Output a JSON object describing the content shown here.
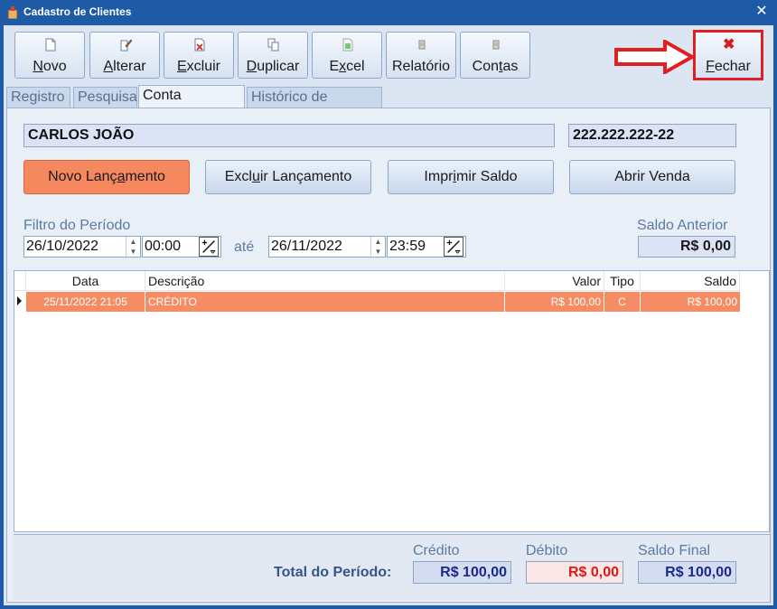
{
  "window": {
    "title": "Cadastro de Clientes",
    "close_glyph": "✕"
  },
  "toolbar": {
    "novo": {
      "label": "Novo",
      "icon": "new-document-icon"
    },
    "alterar": {
      "label": "Alterar",
      "icon": "edit-document-icon"
    },
    "excluir": {
      "label": "Excluir",
      "icon": "delete-document-icon"
    },
    "duplicar": {
      "label": "Duplicar",
      "icon": "duplicate-document-icon"
    },
    "excel": {
      "label": "Excel",
      "icon": "excel-icon"
    },
    "relatorio": {
      "label": "Relatório",
      "icon": "report-icon"
    },
    "contas": {
      "label": "Contas",
      "icon": "accounts-icon"
    },
    "fechar": {
      "label": "Fechar",
      "icon": "close-icon",
      "glyph": "✖"
    }
  },
  "tabs": [
    "Registro",
    "Pesquisa",
    "Conta Corrente",
    "Histórico de Vendas"
  ],
  "client": {
    "name": "CARLOS JOÃO",
    "document": "222.222.222-22"
  },
  "actions": {
    "novo_lancamento": "Novo Lançamento",
    "excluir_lancamento": "Excluir Lançamento",
    "imprimir_saldo": "Imprimir Saldo",
    "abrir_venda": "Abrir Venda"
  },
  "filter": {
    "label": "Filtro do Período",
    "start_date": "26/10/2022",
    "start_time": "00:00",
    "until_label": "até",
    "end_date": "26/11/2022",
    "end_time": "23:59"
  },
  "saldo_anterior": {
    "label": "Saldo Anterior",
    "value": "R$ 0,00"
  },
  "grid": {
    "columns": [
      "Data",
      "Descrição",
      "Valor",
      "Tipo",
      "Saldo"
    ],
    "rows": [
      {
        "data": "25/11/2022 21:05",
        "descricao": "CRÉDITO",
        "valor": "R$ 100,00",
        "tipo": "C",
        "saldo": "R$ 100,00"
      }
    ]
  },
  "totals": {
    "label": "Total do Período:",
    "credito_label": "Crédito",
    "credito": "R$ 100,00",
    "debito_label": "Débito",
    "debito": "R$ 0,00",
    "saldo_final_label": "Saldo Final",
    "saldo_final": "R$ 100,00"
  },
  "colors": {
    "accent_orange": "#f58c64",
    "highlight_red": "#e02020",
    "title_blue": "#1f5aa6",
    "debito_text": "#e01818",
    "credito_text": "#1a2a8c"
  }
}
